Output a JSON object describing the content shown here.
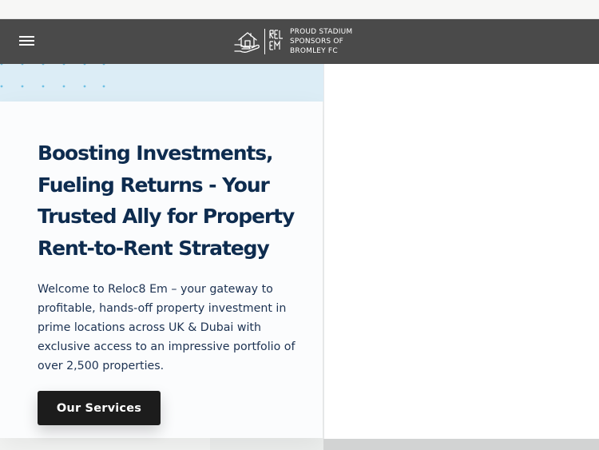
{
  "colors": {
    "navbar": "#4a4a4a",
    "heading": "#0e2c4f",
    "body_text": "#1c3252",
    "button": "#1c1c1c",
    "button_text": "#ffffff",
    "accent_blue": "#dcedf6",
    "dot_blue": "#6fc0e4"
  },
  "header": {
    "menu_icon": "hamburger-menu-icon",
    "logo": {
      "icon": "house-in-hand-icon",
      "mark_text": "RELOC8 EM",
      "tagline": [
        "PROUD STADIUM",
        "SPONSORS OF",
        "BROMLEY FC"
      ]
    }
  },
  "hero": {
    "title": "Boosting Investments, Fueling Returns - Your Trusted Ally for Property Rent-to-Rent Strategy",
    "description": "Welcome to Reloc8 Em – your gateway to profitable, hands-off property investment in prime locations across UK & Dubai with exclusive access to an impressive portfolio of over 2,500 properties.",
    "cta_label": "Our Services"
  }
}
